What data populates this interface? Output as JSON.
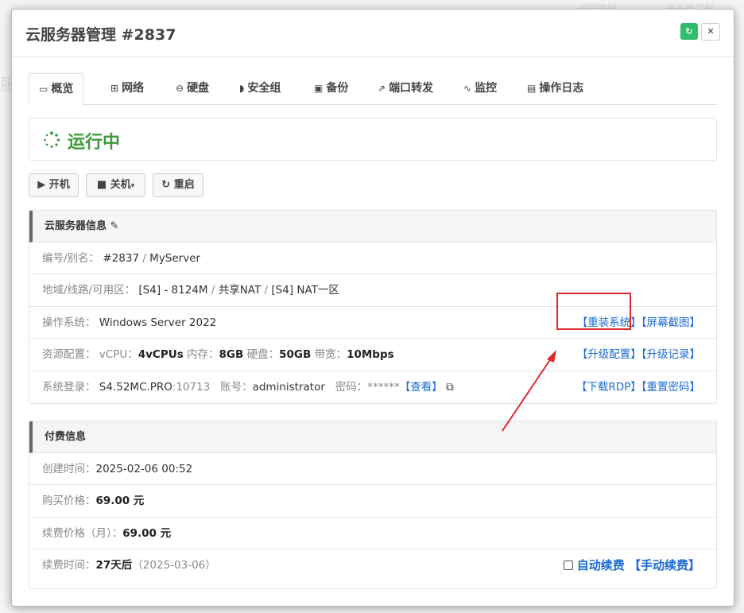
{
  "modal": {
    "title": "云服务器管理 #2837"
  },
  "tabs": [
    {
      "label": "概览",
      "icon": "monitor-icon",
      "active": true
    },
    {
      "label": "网络",
      "icon": "sitemap-icon"
    },
    {
      "label": "硬盘",
      "icon": "hdd-icon"
    },
    {
      "label": "安全组",
      "icon": "shield-icon"
    },
    {
      "label": "备份",
      "icon": "save-icon"
    },
    {
      "label": "端口转发",
      "icon": "external-link-icon"
    },
    {
      "label": "监控",
      "icon": "pulse-icon"
    },
    {
      "label": "操作日志",
      "icon": "file-icon"
    }
  ],
  "status": {
    "text": "运行中",
    "color": "#3d9a3d"
  },
  "controls": {
    "start": "开机",
    "shutdown": "关机",
    "restart": "重启"
  },
  "server_info": {
    "title": "云服务器信息",
    "id": {
      "label": "编号/别名：",
      "number": "#2837",
      "sep": " / ",
      "alias": "MyServer"
    },
    "region": {
      "label": "地域/线路/可用区：",
      "a": "[S4] - 8124M",
      "b": "共享NAT",
      "c": "[S4] NAT一区",
      "sep": " / "
    },
    "os": {
      "label": "操作系统：",
      "value": "Windows Server 2022",
      "reinstall": "【重装系统】",
      "screenshot": "【屏幕截图】"
    },
    "resources": {
      "label": "资源配置：",
      "vcpu_label": "vCPU：",
      "vcpu": "4vCPUs",
      "mem_label": "内存：",
      "mem": "8GB",
      "disk_label": "硬盘：",
      "disk": "50GB",
      "bw_label": "带宽：",
      "bw": "10Mbps",
      "upgrade": "【升级配置】",
      "upgrade_log": "【升级记录】"
    },
    "login": {
      "label": "系统登录：",
      "host": "S4.52MC.PRO",
      "port": ":10713",
      "account_label": "账号：",
      "account": "administrator",
      "pwd_label": "密码：",
      "pwd": "******",
      "view": "【查看】",
      "rdp": "【下载RDP】",
      "reset": "【重置密码】"
    }
  },
  "billing": {
    "title": "付费信息",
    "created": {
      "label": "创建时间：",
      "value": "2025-02-06 00:52"
    },
    "price": {
      "label": "购买价格：",
      "value": "69.00 元"
    },
    "renew_price": {
      "label": "续费价格（月）：",
      "value": "69.00 元"
    },
    "renew_time": {
      "label": "续费时间：",
      "value": "27天后",
      "date": "（2025-03-06）",
      "auto": "自动续费",
      "manual": "【手动续费】"
    }
  },
  "background": {
    "left_char": "服",
    "tr1": "返回官网",
    "tr2": "官方售后群"
  },
  "colors": {
    "accent_green": "#2ebd6b",
    "link": "#1a6cd1",
    "highlight": "#e02a2a"
  }
}
